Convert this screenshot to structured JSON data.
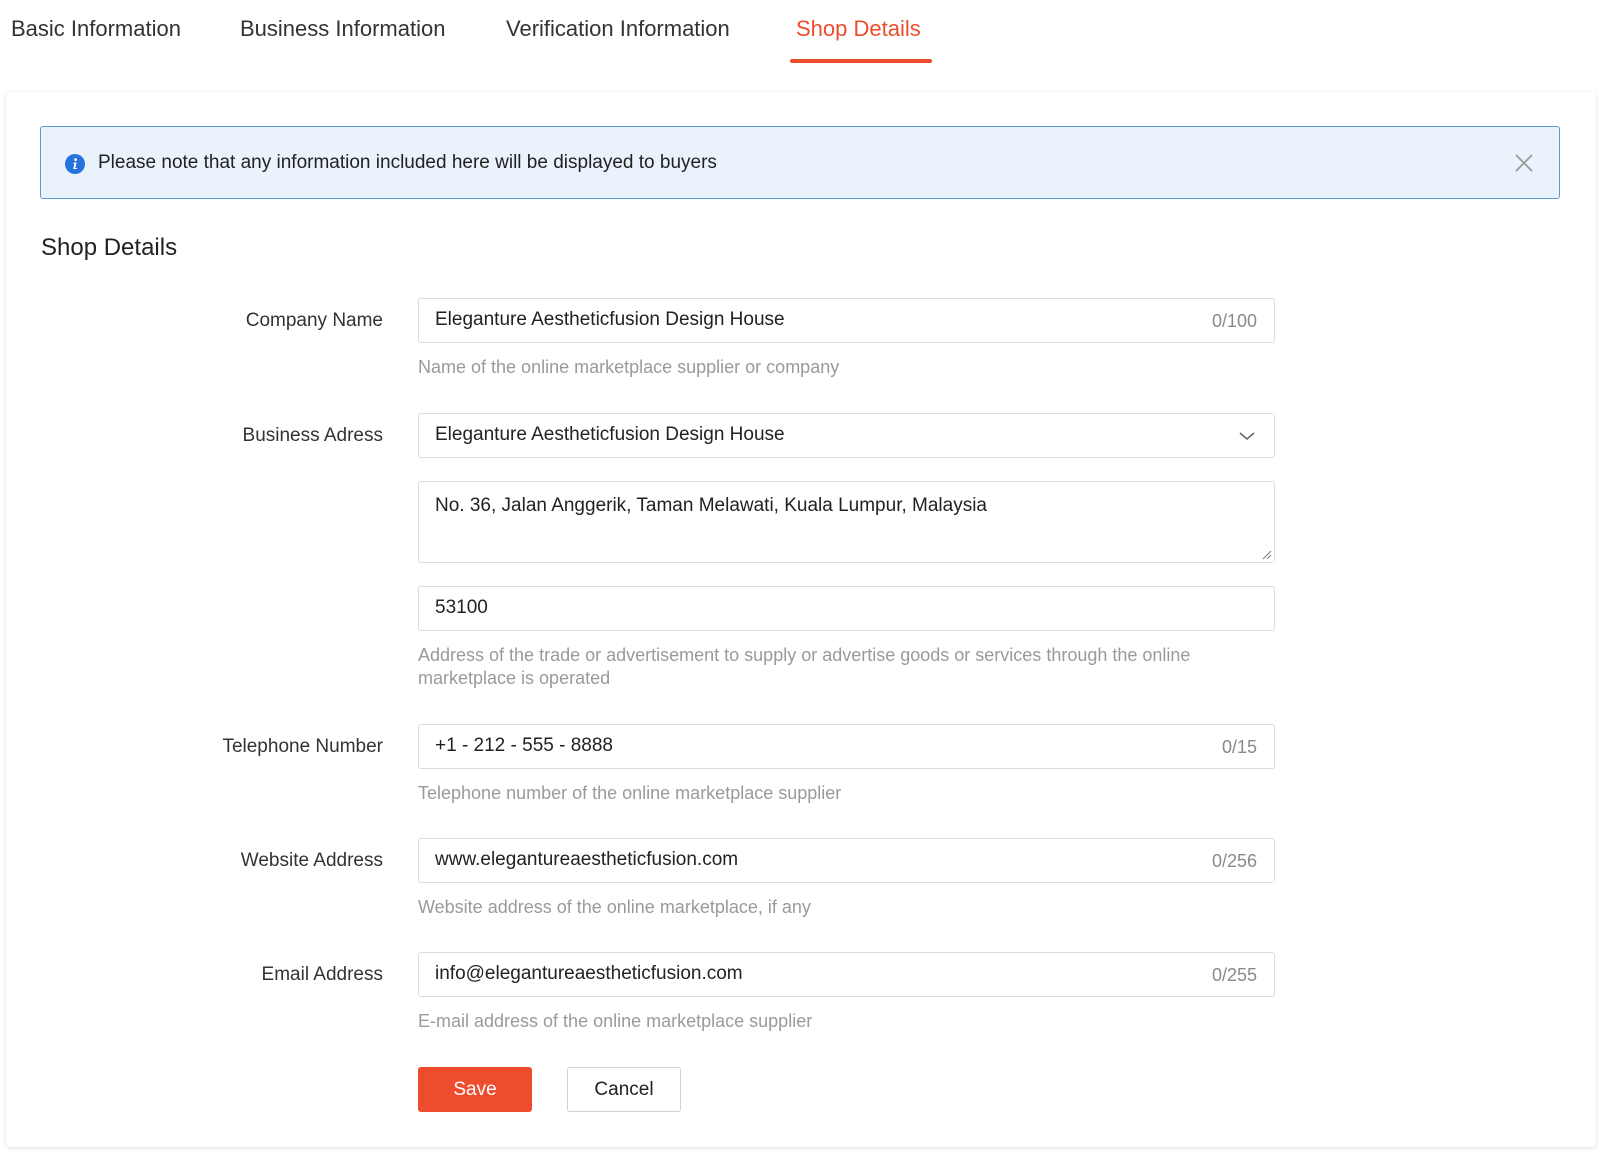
{
  "tabs": {
    "items": [
      {
        "label": "Basic Information"
      },
      {
        "label": "Business Information"
      },
      {
        "label": "Verification Information"
      },
      {
        "label": "Shop Details"
      }
    ],
    "active_index": 3
  },
  "notice": {
    "text": "Please note that any information included here will be displayed to buyers",
    "icon": "info-icon"
  },
  "section": {
    "title": "Shop Details"
  },
  "form": {
    "company_name": {
      "label": "Company Name",
      "value": "Eleganture Aestheticfusion Design House",
      "count": "0/100",
      "hint": "Name of the online marketplace supplier or company"
    },
    "business_address": {
      "label": "Business Adress",
      "select_value": "Eleganture Aestheticfusion Design House",
      "address_value": "No. 36, Jalan Anggerik, Taman Melawati, Kuala Lumpur, Malaysia",
      "postcode_value": "53100",
      "hint": "Address of the trade or advertisement to supply or advertise goods or services through the online marketplace is operated"
    },
    "telephone": {
      "label": "Telephone Number",
      "value": "+1 - 212 - 555 - 8888",
      "count": "0/15",
      "hint": "Telephone number of the online marketplace supplier"
    },
    "website": {
      "label": "Website Address",
      "value": "www.elegantureaestheticfusion.com",
      "count": "0/256",
      "hint": "Website address of the online marketplace, if any"
    },
    "email": {
      "label": "Email Address",
      "value": "info@elegantureaestheticfusion.com",
      "count": "0/255",
      "hint": "E-mail address of the online marketplace supplier"
    }
  },
  "actions": {
    "save_label": "Save",
    "cancel_label": "Cancel"
  },
  "colors": {
    "accent": "#ee4d2d",
    "info_blue": "#2673dd",
    "notice_bg": "#eaf2fc"
  }
}
